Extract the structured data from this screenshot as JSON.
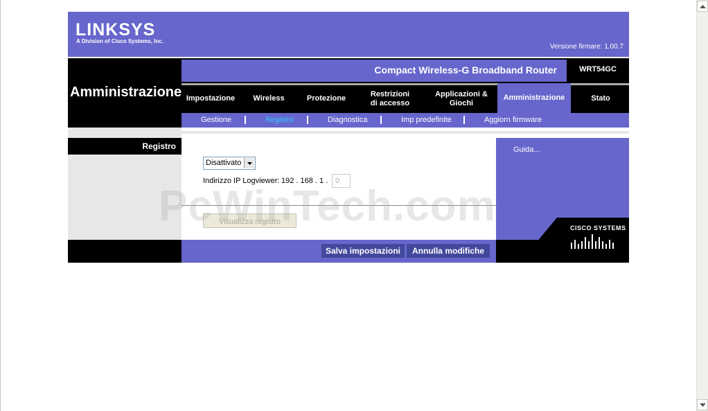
{
  "header": {
    "logo_text": "LINKSYS",
    "logo_subtext": "A Division of Cisco Systems, Inc.",
    "firmware_version": "Versione firmare: 1.00.7",
    "product_name": "Compact Wireless-G Broadband Router",
    "model": "WRT54GC"
  },
  "section_title": "Amministrazione",
  "tabs": [
    {
      "label": "Impostazione"
    },
    {
      "label": "Wireless"
    },
    {
      "label": "Protezione"
    },
    {
      "label": "Restrizioni di accesso"
    },
    {
      "label": "Applicazioni & Giochi"
    },
    {
      "label": "Amministrazione",
      "active": true
    },
    {
      "label": "Stato"
    }
  ],
  "subtabs": [
    {
      "label": "Gestione"
    },
    {
      "label": "Registro",
      "active": true
    },
    {
      "label": "Diagnostica"
    },
    {
      "label": "Imp predefinite"
    },
    {
      "label": "Aggiorn firmware"
    }
  ],
  "left": {
    "section_label": "Registro"
  },
  "form": {
    "log_select": {
      "value": "Disattivato",
      "options": [
        "Disattivato"
      ]
    },
    "logviewer_label": "Indirizzo IP Logviewer:",
    "ip_prefix": "192 . 168 . 1 .",
    "ip_last_value": "0",
    "view_log_button": "Visualizza registro"
  },
  "help": {
    "link": "Guida..."
  },
  "footer": {
    "save_button": "Salva impostazioni",
    "cancel_button": "Annulla modifiche",
    "cisco_logo_text": "CISCO SYSTEMS"
  },
  "watermark": "PcWinTech.com",
  "colors": {
    "purple": "#6666cc",
    "dark_button": "#42499c",
    "active_subtab": "#33ccff",
    "black": "#000000",
    "grey_panel": "#e7e7e7"
  }
}
